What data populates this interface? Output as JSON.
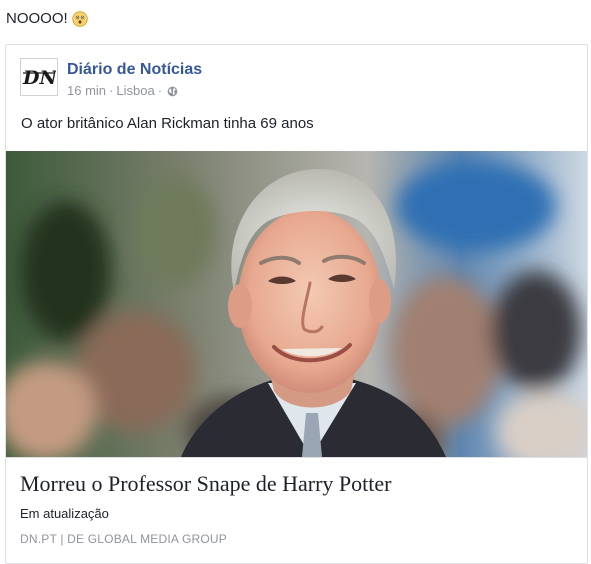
{
  "status": {
    "text": "NOOOO!",
    "emoji": "astonished-emoji-icon"
  },
  "post": {
    "page_name": "Diário de Notícias",
    "logo_text": "DN",
    "time": "16 min",
    "separator": "·",
    "location": "Lisboa",
    "audience_icon": "globe-icon",
    "text": "O ator britânico Alan Rickman tinha 69 anos"
  },
  "link": {
    "title": "Morreu o Professor Snape de Harry Potter",
    "description": "Em atualização",
    "source": "DN.PT | DE GLOBAL MEDIA GROUP"
  },
  "colors": {
    "link_blue": "#365899",
    "text": "#1d2129",
    "muted": "#90949c",
    "border": "#dddfe2"
  }
}
